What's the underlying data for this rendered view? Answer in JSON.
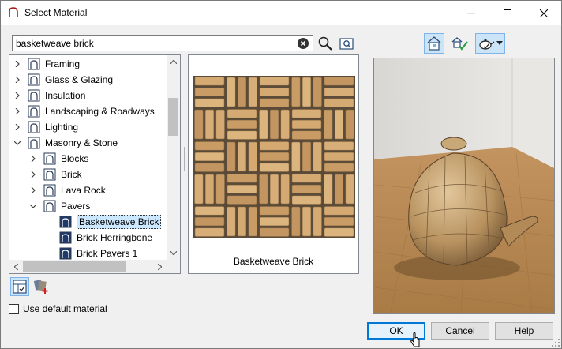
{
  "window": {
    "title": "Select Material"
  },
  "search": {
    "value": "basketweave brick",
    "placeholder": ""
  },
  "tree": {
    "items": [
      {
        "label": "Framing",
        "level": 0,
        "expanded": false
      },
      {
        "label": "Glass & Glazing",
        "level": 0,
        "expanded": false
      },
      {
        "label": "Insulation",
        "level": 0,
        "expanded": false
      },
      {
        "label": "Landscaping & Roadways",
        "level": 0,
        "expanded": false
      },
      {
        "label": "Lighting",
        "level": 0,
        "expanded": false
      },
      {
        "label": "Masonry & Stone",
        "level": 0,
        "expanded": true
      },
      {
        "label": "Blocks",
        "level": 1,
        "expanded": false
      },
      {
        "label": "Brick",
        "level": 1,
        "expanded": false
      },
      {
        "label": "Lava Rock",
        "level": 1,
        "expanded": false
      },
      {
        "label": "Pavers",
        "level": 1,
        "expanded": true
      },
      {
        "label": "Basketweave Brick",
        "level": 2,
        "selected": true
      },
      {
        "label": "Brick Herringbone",
        "level": 2
      },
      {
        "label": "Brick Pavers 1",
        "level": 2
      }
    ]
  },
  "preview": {
    "caption": "Basketweave Brick"
  },
  "options": {
    "use_default_label": "Use default material",
    "use_default_checked": false
  },
  "buttons": {
    "ok": "OK",
    "cancel": "Cancel",
    "help": "Help"
  },
  "colors": {
    "accent": "#0078d7",
    "selection": "#cce8ff",
    "brick": "#c9a06a",
    "floor": "#b98a55",
    "wall": "#e8e6e2"
  }
}
